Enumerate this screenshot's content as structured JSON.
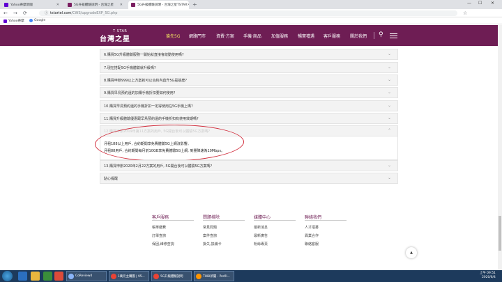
{
  "browser": {
    "tabs": [
      {
        "label": "Yahoo奇摩新聞",
        "active": false
      },
      {
        "label": "5G升級體驗說明 - 台灣之星",
        "active": false
      },
      {
        "label": "5G升級體驗說明 - 台灣之星TSTAR",
        "active": true
      }
    ],
    "url_host": "tstartel.com",
    "url_path": "/CWS/upgradeEXP_5G.php",
    "bookmarks": [
      "Yahoo奇摩",
      "Google"
    ]
  },
  "site": {
    "logo_top": "T STAR",
    "logo_main": "台灣之星",
    "menu": [
      {
        "label": "搶先5G",
        "active": true
      },
      {
        "label": "網路門市",
        "active": false
      },
      {
        "label": "資費·方案",
        "active": false
      },
      {
        "label": "手機·商品",
        "active": false
      },
      {
        "label": "加值服務",
        "active": false
      },
      {
        "label": "暢實禮遇",
        "active": false
      },
      {
        "label": "客戶服務",
        "active": false
      },
      {
        "label": "關於我們",
        "active": false
      }
    ]
  },
  "faq": [
    {
      "q": "6.購買5G升級體驗服務一開始就直接會啟動使用嗎?"
    },
    {
      "q": "7.現在搭配5G手機體驗就升級嗎?"
    },
    {
      "q": "8.購買申辦999以上方案就可以合約內直升5G是甚麼?"
    },
    {
      "q": "9.購買早鳥預約還的加購手機折扣要如何使用?"
    },
    {
      "q": "10.購買早鳥預約還的手機折扣一定得使用在5G手機上嗎?"
    },
    {
      "q": "11.購買升級體驗優惠跟早鳥預約還的手機折扣有使用效期嗎?"
    },
    {
      "q": "12.購買申辦2019年第11方案的用戶, 5G開台後可以體驗5G方案嗎?"
    },
    {
      "q": "13.購買申辦2020年2月22方案的用戶, 5G開台後可以體驗5G方案嗎?"
    },
    {
      "q": "貼心提醒"
    }
  ],
  "faq_answer": {
    "line1": "月租188以上用戶, 合約期間享免費體驗5G上網沒影響。",
    "line2": "月租88用戶, 合約期間每月前10GB享免費體驗5G上網, 到量降速為10Mbps。"
  },
  "footer": [
    {
      "title": "客戶服務",
      "links": [
        "帳單繳費",
        "訂單查詢",
        "保固,維修查詢"
      ]
    },
    {
      "title": "問題排除",
      "links": [
        "常見問題",
        "案件查詢",
        "掛失,換補卡"
      ]
    },
    {
      "title": "媒體中心",
      "links": [
        "最新消息",
        "最新廣告",
        "粉絲專頁"
      ]
    },
    {
      "title": "聯絡我們",
      "links": [
        "人才招募",
        "異業合作",
        "聯絡客服"
      ]
    }
  ],
  "taskbar": {
    "apps": [
      "CoReview4",
      "1萬元主購團 | 95...",
      "5G升級體驗說明",
      "TOBI新聞 - Profil..."
    ],
    "time": "上午 09:51",
    "date": "2020/6/4"
  },
  "colors": {
    "brand": "#6e1d54",
    "highlight": "#d12b3a",
    "menu_active": "#f0e060"
  }
}
